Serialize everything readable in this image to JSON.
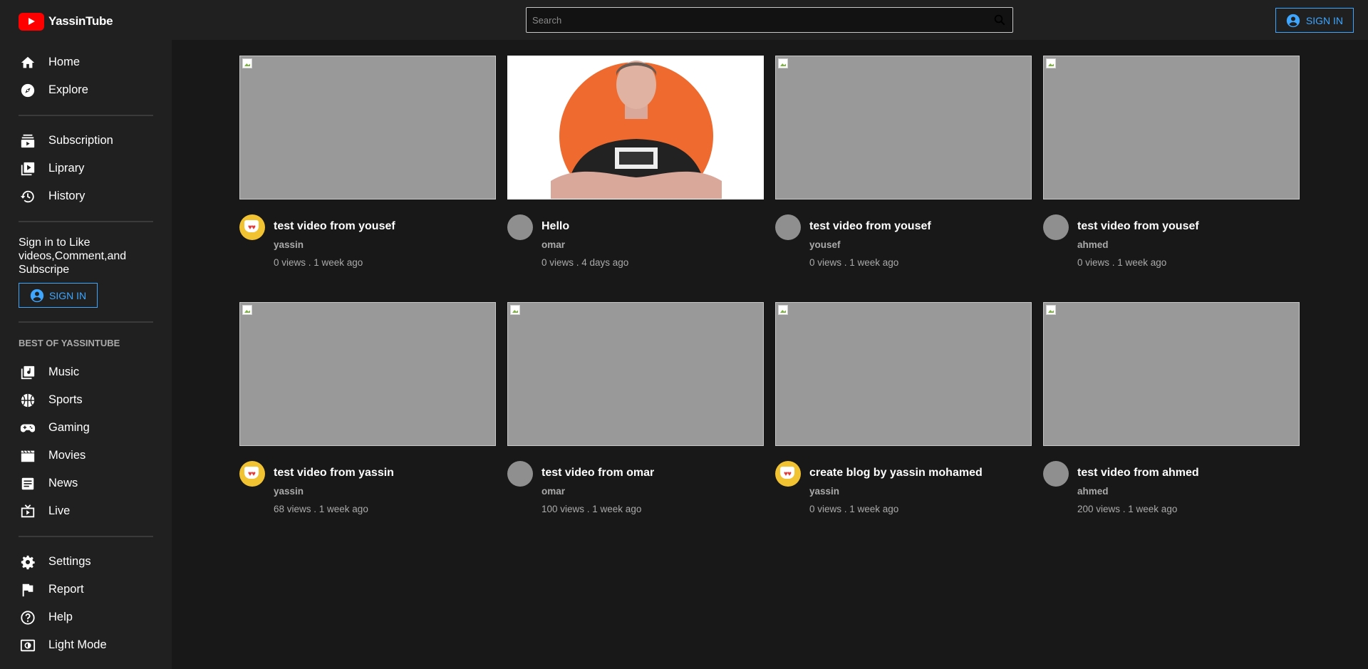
{
  "app": {
    "name": "YassinTube"
  },
  "search": {
    "placeholder": "Search"
  },
  "header": {
    "signin_label": "SIGN IN"
  },
  "sidebar": {
    "primary": [
      {
        "label": "Home",
        "icon": "home-icon"
      },
      {
        "label": "Explore",
        "icon": "compass-icon"
      }
    ],
    "library": [
      {
        "label": "Subscription",
        "icon": "subscriptions-icon"
      },
      {
        "label": "Liprary",
        "icon": "video-library-icon"
      },
      {
        "label": "History",
        "icon": "history-icon"
      }
    ],
    "signin_prompt": "Sign in to Like videos,Comment,and Subscripe",
    "signin_label": "SIGN IN",
    "best_of_title": "BEST OF YASSINTUBE",
    "categories": [
      {
        "label": "Music",
        "icon": "music-library-icon"
      },
      {
        "label": "Sports",
        "icon": "sports-ball-icon"
      },
      {
        "label": "Gaming",
        "icon": "gamepad-icon"
      },
      {
        "label": "Movies",
        "icon": "movie-clapper-icon"
      },
      {
        "label": "News",
        "icon": "news-article-icon"
      },
      {
        "label": "Live",
        "icon": "live-tv-icon"
      }
    ],
    "settings": [
      {
        "label": "Settings",
        "icon": "gear-icon"
      },
      {
        "label": "Report",
        "icon": "flag-icon"
      },
      {
        "label": "Help",
        "icon": "help-circle-icon"
      },
      {
        "label": "Light Mode",
        "icon": "light-mode-icon"
      }
    ]
  },
  "videos": [
    {
      "title": "test video from yousef",
      "channel": "yassin",
      "stats": "0 views . 1 week ago",
      "avatar": "emoji",
      "thumb": "broken"
    },
    {
      "title": "Hello",
      "channel": "omar",
      "stats": "0 views . 4 days ago",
      "avatar": "gray",
      "thumb": "photo"
    },
    {
      "title": "test video from yousef",
      "channel": "yousef",
      "stats": "0 views . 1 week ago",
      "avatar": "gray",
      "thumb": "broken"
    },
    {
      "title": "test video from yousef",
      "channel": "ahmed",
      "stats": "0 views . 1 week ago",
      "avatar": "gray",
      "thumb": "broken"
    },
    {
      "title": "test video from yassin",
      "channel": "yassin",
      "stats": "68 views . 1 week ago",
      "avatar": "emoji",
      "thumb": "broken"
    },
    {
      "title": "test video from omar",
      "channel": "omar",
      "stats": "100 views . 1 week ago",
      "avatar": "gray",
      "thumb": "broken"
    },
    {
      "title": "create blog by yassin mohamed",
      "channel": "yassin",
      "stats": "0 views . 1 week ago",
      "avatar": "emoji",
      "thumb": "broken"
    },
    {
      "title": "test video from ahmed",
      "channel": "ahmed",
      "stats": "200 views . 1 week ago",
      "avatar": "gray",
      "thumb": "broken"
    }
  ],
  "colors": {
    "accent": "#3ea6ff",
    "brand": "#ff0000",
    "background": "#181818",
    "sidebar": "#202020"
  }
}
